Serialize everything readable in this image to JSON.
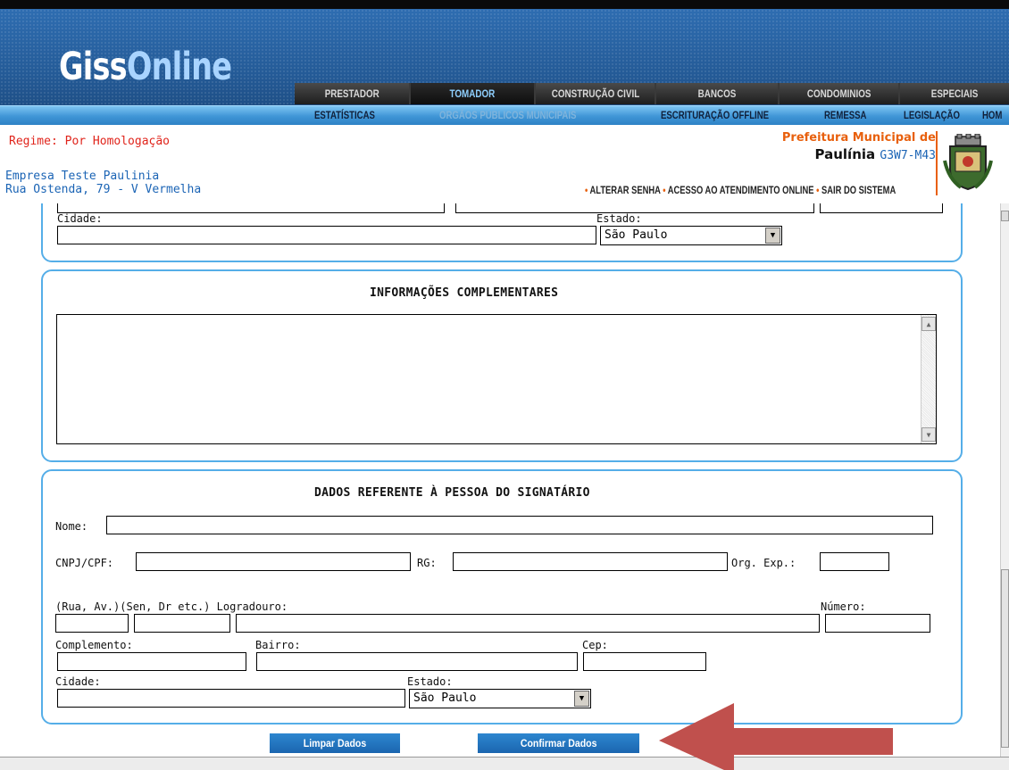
{
  "brand": {
    "logo_part1": "Giss",
    "logo_part2": "Online"
  },
  "tabs": [
    {
      "label": "PRESTADOR"
    },
    {
      "label": "TOMADOR"
    },
    {
      "label": "CONSTRUÇÃO CIVIL"
    },
    {
      "label": "BANCOS"
    },
    {
      "label": "CONDOMINIOS"
    },
    {
      "label": "ESPECIAIS"
    }
  ],
  "nav": [
    {
      "label": "ESTATÍSTICAS"
    },
    {
      "label": "ORGÃOS PÚBLICOS MUNICIPAIS"
    },
    {
      "label": "ESCRITURAÇÃO OFFLINE"
    },
    {
      "label": "REMESSA"
    },
    {
      "label": "LEGISLAÇÃO"
    },
    {
      "label": "HOM"
    }
  ],
  "session": {
    "regime": "Regime: Por Homologação",
    "empresa_nome": "Empresa Teste Paulinia",
    "empresa_endereco": "Rua Ostenda, 79 - V Vermelha"
  },
  "prefeitura": {
    "line1": "Prefeitura Municipal de",
    "city": "Paulínia",
    "code": "G3W7-M43"
  },
  "links": {
    "alterar_senha": "ALTERAR SENHA",
    "atendimento": "ACESSO AO ATENDIMENTO ONLINE",
    "sair": "SAIR DO SISTEMA",
    "bullet": "•"
  },
  "address_block": {
    "cidade_label": "Cidade:",
    "estado_label": "Estado:",
    "estado_value": "São Paulo"
  },
  "info": {
    "title": "INFORMAÇÕES COMPLEMENTARES",
    "textarea_value": ""
  },
  "signatario": {
    "title": "DADOS REFERENTE À PESSOA DO SIGNATÁRIO",
    "nome_label": "Nome:",
    "cnpj_label": "CNPJ/CPF:",
    "rg_label": "RG:",
    "orgexp_label": "Org. Exp.:",
    "logradouro_label": "(Rua, Av.)(Sen, Dr etc.) Logradouro:",
    "numero_label": "Número:",
    "complemento_label": "Complemento:",
    "bairro_label": "Bairro:",
    "cep_label": "Cep:",
    "cidade_label": "Cidade:",
    "estado_label": "Estado:",
    "estado_value": "São Paulo"
  },
  "buttons": {
    "limpar": "Limpar Dados",
    "confirmar": "Confirmar Dados"
  },
  "colors": {
    "accent_blue": "#1b64b5",
    "panel_border": "#55aee8",
    "regime_red": "#e0241b",
    "pref_orange": "#e8600d",
    "annotation_arrow": "#c0504d"
  }
}
